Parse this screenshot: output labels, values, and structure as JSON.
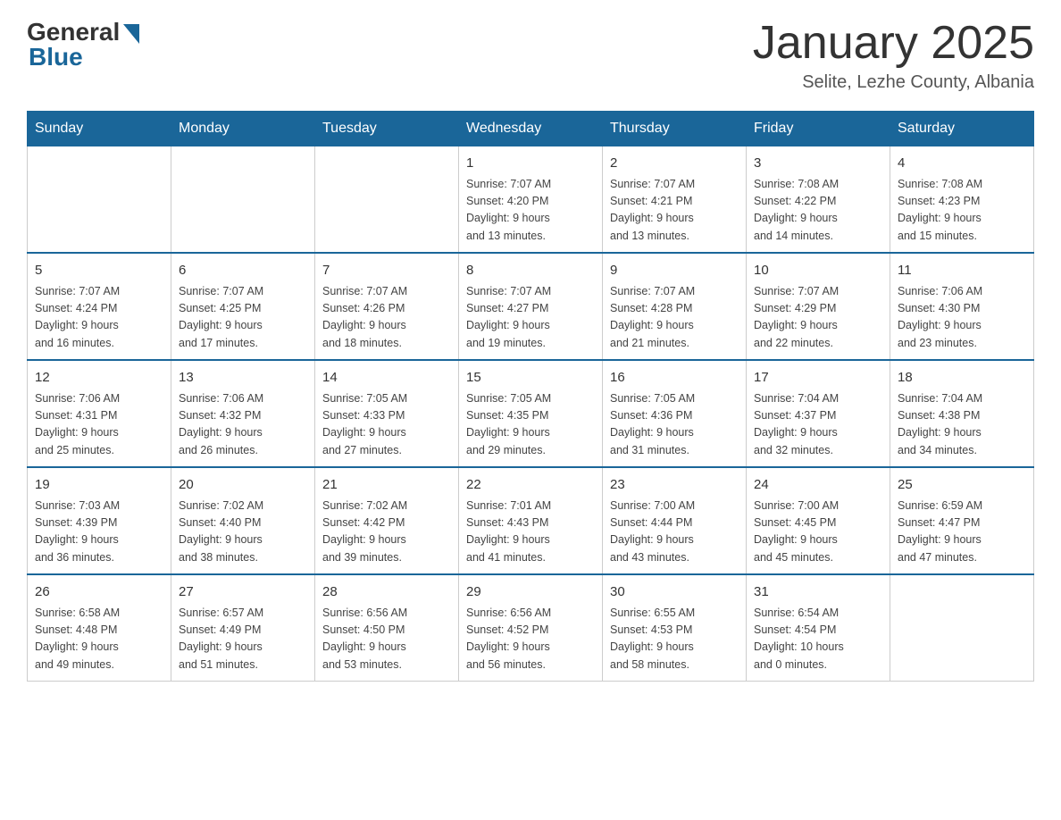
{
  "header": {
    "logo_general": "General",
    "logo_blue": "Blue",
    "month_title": "January 2025",
    "location": "Selite, Lezhe County, Albania"
  },
  "weekdays": [
    "Sunday",
    "Monday",
    "Tuesday",
    "Wednesday",
    "Thursday",
    "Friday",
    "Saturday"
  ],
  "weeks": [
    {
      "days": [
        {
          "number": "",
          "info": ""
        },
        {
          "number": "",
          "info": ""
        },
        {
          "number": "",
          "info": ""
        },
        {
          "number": "1",
          "info": "Sunrise: 7:07 AM\nSunset: 4:20 PM\nDaylight: 9 hours\nand 13 minutes."
        },
        {
          "number": "2",
          "info": "Sunrise: 7:07 AM\nSunset: 4:21 PM\nDaylight: 9 hours\nand 13 minutes."
        },
        {
          "number": "3",
          "info": "Sunrise: 7:08 AM\nSunset: 4:22 PM\nDaylight: 9 hours\nand 14 minutes."
        },
        {
          "number": "4",
          "info": "Sunrise: 7:08 AM\nSunset: 4:23 PM\nDaylight: 9 hours\nand 15 minutes."
        }
      ]
    },
    {
      "days": [
        {
          "number": "5",
          "info": "Sunrise: 7:07 AM\nSunset: 4:24 PM\nDaylight: 9 hours\nand 16 minutes."
        },
        {
          "number": "6",
          "info": "Sunrise: 7:07 AM\nSunset: 4:25 PM\nDaylight: 9 hours\nand 17 minutes."
        },
        {
          "number": "7",
          "info": "Sunrise: 7:07 AM\nSunset: 4:26 PM\nDaylight: 9 hours\nand 18 minutes."
        },
        {
          "number": "8",
          "info": "Sunrise: 7:07 AM\nSunset: 4:27 PM\nDaylight: 9 hours\nand 19 minutes."
        },
        {
          "number": "9",
          "info": "Sunrise: 7:07 AM\nSunset: 4:28 PM\nDaylight: 9 hours\nand 21 minutes."
        },
        {
          "number": "10",
          "info": "Sunrise: 7:07 AM\nSunset: 4:29 PM\nDaylight: 9 hours\nand 22 minutes."
        },
        {
          "number": "11",
          "info": "Sunrise: 7:06 AM\nSunset: 4:30 PM\nDaylight: 9 hours\nand 23 minutes."
        }
      ]
    },
    {
      "days": [
        {
          "number": "12",
          "info": "Sunrise: 7:06 AM\nSunset: 4:31 PM\nDaylight: 9 hours\nand 25 minutes."
        },
        {
          "number": "13",
          "info": "Sunrise: 7:06 AM\nSunset: 4:32 PM\nDaylight: 9 hours\nand 26 minutes."
        },
        {
          "number": "14",
          "info": "Sunrise: 7:05 AM\nSunset: 4:33 PM\nDaylight: 9 hours\nand 27 minutes."
        },
        {
          "number": "15",
          "info": "Sunrise: 7:05 AM\nSunset: 4:35 PM\nDaylight: 9 hours\nand 29 minutes."
        },
        {
          "number": "16",
          "info": "Sunrise: 7:05 AM\nSunset: 4:36 PM\nDaylight: 9 hours\nand 31 minutes."
        },
        {
          "number": "17",
          "info": "Sunrise: 7:04 AM\nSunset: 4:37 PM\nDaylight: 9 hours\nand 32 minutes."
        },
        {
          "number": "18",
          "info": "Sunrise: 7:04 AM\nSunset: 4:38 PM\nDaylight: 9 hours\nand 34 minutes."
        }
      ]
    },
    {
      "days": [
        {
          "number": "19",
          "info": "Sunrise: 7:03 AM\nSunset: 4:39 PM\nDaylight: 9 hours\nand 36 minutes."
        },
        {
          "number": "20",
          "info": "Sunrise: 7:02 AM\nSunset: 4:40 PM\nDaylight: 9 hours\nand 38 minutes."
        },
        {
          "number": "21",
          "info": "Sunrise: 7:02 AM\nSunset: 4:42 PM\nDaylight: 9 hours\nand 39 minutes."
        },
        {
          "number": "22",
          "info": "Sunrise: 7:01 AM\nSunset: 4:43 PM\nDaylight: 9 hours\nand 41 minutes."
        },
        {
          "number": "23",
          "info": "Sunrise: 7:00 AM\nSunset: 4:44 PM\nDaylight: 9 hours\nand 43 minutes."
        },
        {
          "number": "24",
          "info": "Sunrise: 7:00 AM\nSunset: 4:45 PM\nDaylight: 9 hours\nand 45 minutes."
        },
        {
          "number": "25",
          "info": "Sunrise: 6:59 AM\nSunset: 4:47 PM\nDaylight: 9 hours\nand 47 minutes."
        }
      ]
    },
    {
      "days": [
        {
          "number": "26",
          "info": "Sunrise: 6:58 AM\nSunset: 4:48 PM\nDaylight: 9 hours\nand 49 minutes."
        },
        {
          "number": "27",
          "info": "Sunrise: 6:57 AM\nSunset: 4:49 PM\nDaylight: 9 hours\nand 51 minutes."
        },
        {
          "number": "28",
          "info": "Sunrise: 6:56 AM\nSunset: 4:50 PM\nDaylight: 9 hours\nand 53 minutes."
        },
        {
          "number": "29",
          "info": "Sunrise: 6:56 AM\nSunset: 4:52 PM\nDaylight: 9 hours\nand 56 minutes."
        },
        {
          "number": "30",
          "info": "Sunrise: 6:55 AM\nSunset: 4:53 PM\nDaylight: 9 hours\nand 58 minutes."
        },
        {
          "number": "31",
          "info": "Sunrise: 6:54 AM\nSunset: 4:54 PM\nDaylight: 10 hours\nand 0 minutes."
        },
        {
          "number": "",
          "info": ""
        }
      ]
    }
  ]
}
